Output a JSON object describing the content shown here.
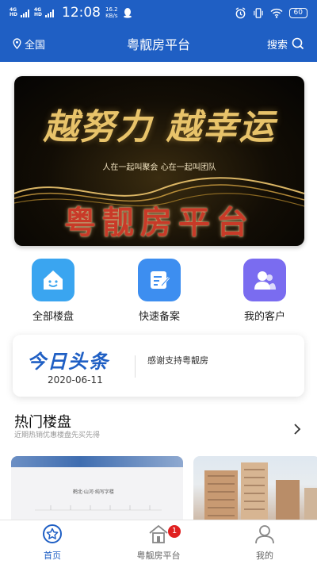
{
  "status_bar": {
    "sim1": "4G HD",
    "sim2": "4G HD",
    "time": "12:08",
    "speed_value": "16.2",
    "speed_unit": "KB/s",
    "battery": "60"
  },
  "header": {
    "location": "全国",
    "title": "粤靓房平台",
    "search_label": "搜索"
  },
  "banner": {
    "line1": "越努力 越幸运",
    "subtitle": "人在一起叫聚会  心在一起叫团队",
    "line2": "粤靓房平台"
  },
  "shortcuts": [
    {
      "label": "全部楼盘",
      "icon": "house-smile-icon",
      "color": "#3aa5f0"
    },
    {
      "label": "快速备案",
      "icon": "edit-document-icon",
      "color": "#3d8ef0"
    },
    {
      "label": "我的客户",
      "icon": "customers-icon",
      "color": "#7a6cf0"
    }
  ],
  "news": {
    "logo": "今日头条",
    "date": "2020-06-11",
    "text": "感谢支持粤靓房"
  },
  "hot": {
    "title": "热门楼盘",
    "subtitle": "近期热销优惠楼盘先买先得",
    "card1_caption": "鹤北·山河·纯写字楼"
  },
  "tabbar": {
    "items": [
      {
        "label": "首页",
        "icon": "home-star-icon",
        "active": true
      },
      {
        "label": "粤靓房平台",
        "icon": "platform-building-icon",
        "active": false,
        "badge": "1"
      },
      {
        "label": "我的",
        "icon": "user-icon",
        "active": false
      }
    ]
  },
  "colors": {
    "brand": "#1f5fc4",
    "badge": "#e02020"
  }
}
